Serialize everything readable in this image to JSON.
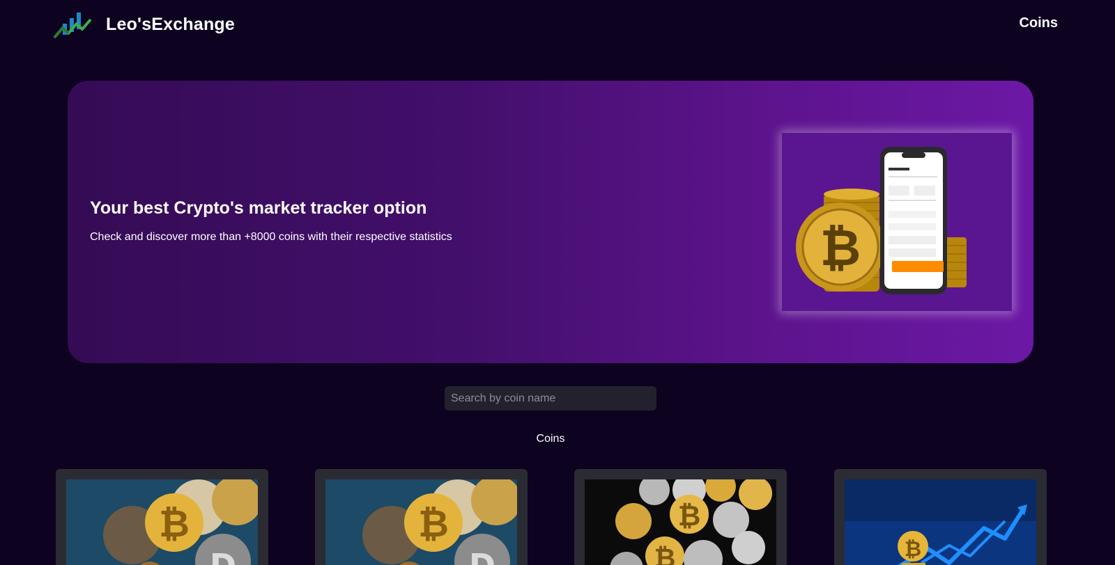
{
  "header": {
    "brand_name": "Leo'sExchange",
    "logo_icon": "chart-growth-logo",
    "nav_coins": "Coins"
  },
  "hero": {
    "title": "Your best Crypto's market tracker option",
    "subtitle": "Check and discover more than +8000 coins with their respective statistics",
    "image": "bitcoin-coins-phone-illustration"
  },
  "search": {
    "placeholder": "Search by coin name",
    "value": ""
  },
  "coins_section": {
    "title": "Coins",
    "cards": [
      {
        "image": "crypto-coins-ethereum-bitcoin-dogecoin"
      },
      {
        "image": "crypto-coins-ethereum-bitcoin-dogecoin"
      },
      {
        "image": "silver-gold-crypto-coins-pile"
      },
      {
        "image": "bitcoin-growth-chart-arrows"
      }
    ]
  },
  "colors": {
    "background": "#0d0320",
    "hero_gradient_start": "#350b55",
    "hero_gradient_end": "#6c18a6",
    "card_background": "#2b2b33",
    "search_background": "#23212e"
  }
}
